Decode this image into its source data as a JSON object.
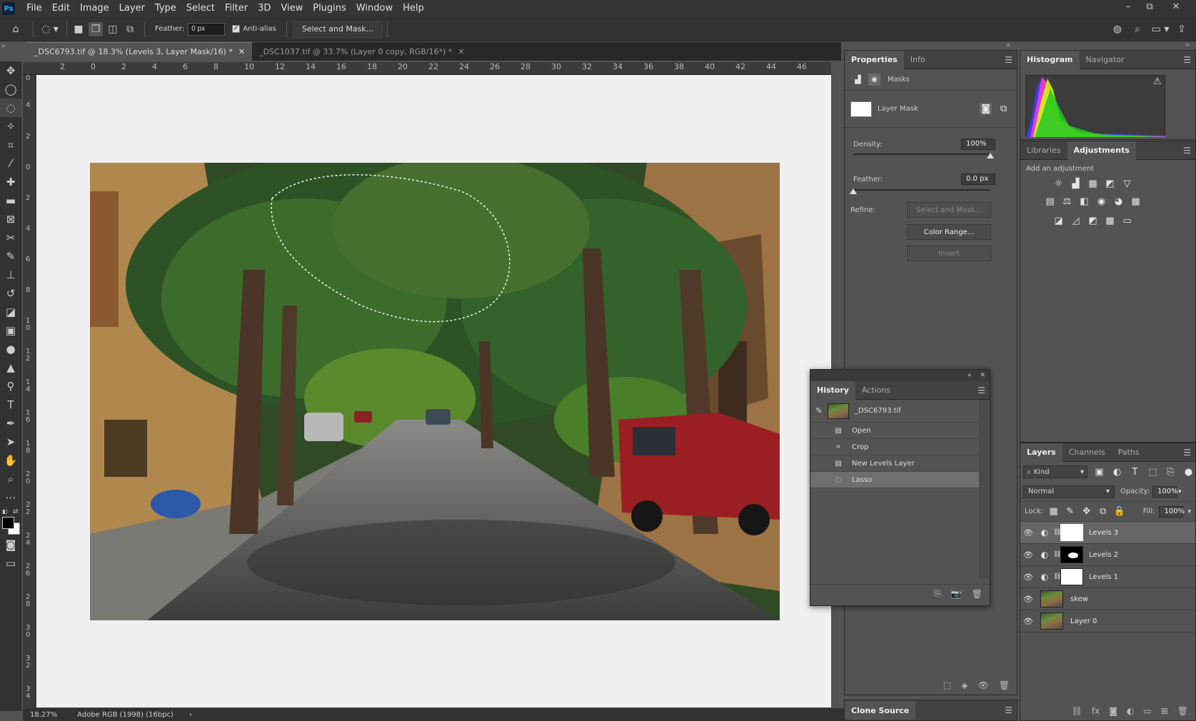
{
  "app": {
    "logo": "Ps"
  },
  "menu": [
    "File",
    "Edit",
    "Image",
    "Layer",
    "Type",
    "Select",
    "Filter",
    "3D",
    "View",
    "Plugins",
    "Window",
    "Help"
  ],
  "window_controls": {
    "minimize": "–",
    "restore": "⧉",
    "close": "✕"
  },
  "options_bar": {
    "feather_label": "Feather:",
    "feather_value": "0 px",
    "antialias_label": "Anti-alias",
    "antialias_checked": true,
    "select_mask_button": "Select and Mask..."
  },
  "doc_tabs": [
    {
      "label": "_DSC6793.tif @ 18.3% (Levels 3, Layer Mask/16) *",
      "active": true
    },
    {
      "label": "_DSC1037.tif @ 33.7% (Layer 0 copy, RGB/16*) *",
      "active": false
    }
  ],
  "ruler_h": [
    "2",
    "0",
    "2",
    "4",
    "6",
    "8",
    "10",
    "12",
    "14",
    "16",
    "18",
    "20",
    "22",
    "24",
    "26",
    "28",
    "30",
    "32",
    "34",
    "36",
    "38",
    "40",
    "42",
    "44",
    "46"
  ],
  "ruler_v": [
    "0",
    "4",
    "2",
    "0",
    "2",
    "4",
    "6",
    "8",
    "10",
    "12",
    "14",
    "16",
    "18",
    "20",
    "22",
    "24",
    "26",
    "28",
    "30",
    "32",
    "34"
  ],
  "status": {
    "zoom": "18.27%",
    "profile": "Adobe RGB (1998) (16bpc)",
    "arrow": "›"
  },
  "properties": {
    "tabs": [
      "Properties",
      "Info"
    ],
    "masks_label": "Masks",
    "layer_mask_label": "Layer Mask",
    "density_label": "Density:",
    "density_value": "100%",
    "density_fraction": 1.0,
    "feather_label": "Feather:",
    "feather_value": "0.0 px",
    "feather_fraction": 0.0,
    "refine_label": "Refine:",
    "select_mask_button": "Select and Mask...",
    "color_range_button": "Color Range...",
    "invert_button": "Invert"
  },
  "clone_source": {
    "label": "Clone Source"
  },
  "histogram": {
    "tabs": [
      "Histogram",
      "Navigator"
    ],
    "warning_icon": "⚠"
  },
  "adjustments": {
    "tabs": [
      "Libraries",
      "Adjustments"
    ],
    "add_label": "Add an adjustment",
    "icons_row1": [
      "☼",
      "▟",
      "▦",
      "◩",
      "▽"
    ],
    "icons_row2": [
      "▤",
      "⚖",
      "◧",
      "◉",
      "◕",
      "▦"
    ],
    "icons_row3": [
      "◪",
      "◿",
      "◩",
      "▩",
      "▭"
    ]
  },
  "history": {
    "tabs": [
      "History",
      "Actions"
    ],
    "snapshot": "_DSC6793.tif",
    "items": [
      {
        "label": "Open",
        "icon": "▤"
      },
      {
        "label": "Crop",
        "icon": "⌗"
      },
      {
        "label": "New Levels Layer",
        "icon": "▤"
      },
      {
        "label": "Lasso",
        "icon": "◌"
      }
    ]
  },
  "layers": {
    "tabs": [
      "Layers",
      "Channels",
      "Paths"
    ],
    "filter_kind": "Kind",
    "blend_mode": "Normal",
    "opacity_label": "Opacity:",
    "opacity_value": "100%",
    "lock_label": "Lock:",
    "fill_label": "Fill:",
    "fill_value": "100%",
    "items": [
      {
        "name": "Levels 3",
        "type": "adjustment",
        "mask": "white",
        "selected": true
      },
      {
        "name": "Levels 2",
        "type": "adjustment",
        "mask": "black",
        "selected": false
      },
      {
        "name": "Levels 1",
        "type": "adjustment",
        "mask": "white",
        "selected": false
      },
      {
        "name": "skew",
        "type": "pixel",
        "selected": false
      },
      {
        "name": "Layer 0",
        "type": "pixel",
        "selected": false
      }
    ]
  }
}
